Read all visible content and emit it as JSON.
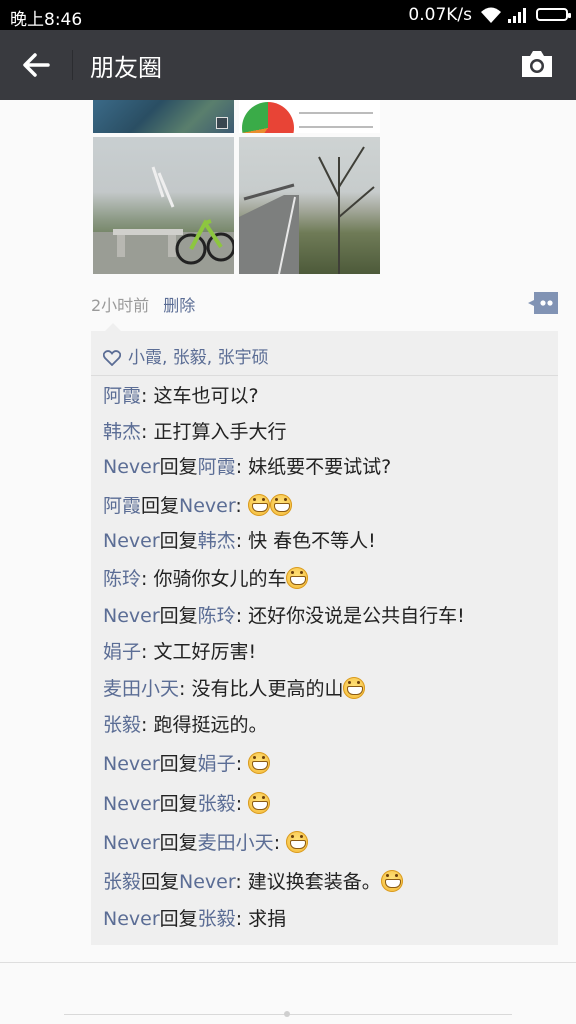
{
  "status_bar": {
    "time": "晚上8:46",
    "network_speed": "0.07K/s",
    "icons": [
      "wifi-icon",
      "signal-icon",
      "battery-icon"
    ]
  },
  "app_bar": {
    "title": "朋友圈",
    "back_icon": "arrow-left-icon",
    "camera_icon": "camera-icon"
  },
  "post": {
    "images": [
      "map-screenshot",
      "stats-screenshot",
      "bicycle-plaza-photo",
      "road-photo"
    ],
    "time_ago": "2小时前",
    "delete_label": "删除",
    "likes": "小霞, 张毅, 张宇硕",
    "comments": [
      {
        "name": "阿霞",
        "reply_to": "",
        "text": ": 这车也可以?",
        "emoji": 0
      },
      {
        "name": "韩杰",
        "reply_to": "",
        "text": ": 正打算入手大行",
        "emoji": 0
      },
      {
        "name": "Never",
        "reply_to": "阿霞",
        "text": ": 妹纸要不要试试?",
        "emoji": 0
      },
      {
        "name": "阿霞",
        "reply_to": "Never",
        "text": ": ",
        "emoji": 2
      },
      {
        "name": "Never",
        "reply_to": "韩杰",
        "text": ": 快 春色不等人!",
        "emoji": 0
      },
      {
        "name": "陈玲",
        "reply_to": "",
        "text": ": 你骑你女儿的车",
        "emoji": 1
      },
      {
        "name": "Never",
        "reply_to": "陈玲",
        "text": ": 还好你没说是公共自行车!",
        "emoji": 0
      },
      {
        "name": "娟子",
        "reply_to": "",
        "text": ": 文工好厉害!",
        "emoji": 0
      },
      {
        "name": "麦田小天",
        "reply_to": "",
        "text": ": 没有比人更高的山",
        "emoji": 1
      },
      {
        "name": "张毅",
        "reply_to": "",
        "text": ": 跑得挺远的。",
        "emoji": 0
      },
      {
        "name": "Never",
        "reply_to": "娟子",
        "text": ": ",
        "emoji": 1
      },
      {
        "name": "Never",
        "reply_to": "张毅",
        "text": ": ",
        "emoji": 1
      },
      {
        "name": "Never",
        "reply_to": "麦田小天",
        "text": ": ",
        "emoji": 1
      },
      {
        "name": "张毅",
        "reply_to": "Never",
        "text": ": 建议换套装备。",
        "emoji": 1
      },
      {
        "name": "Never",
        "reply_to": "张毅",
        "text": ": 求捐",
        "emoji": 0
      }
    ],
    "reply_word": "回复"
  }
}
